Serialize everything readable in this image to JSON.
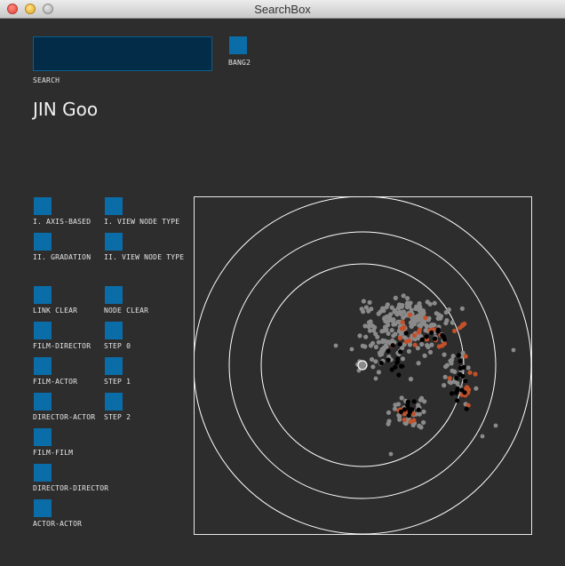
{
  "window": {
    "title": "SearchBox"
  },
  "search": {
    "value": "",
    "label": "SEARCH"
  },
  "bang2": {
    "label": "BANG2"
  },
  "heading": "JIN Goo",
  "buttons": [
    {
      "id": "axis-based",
      "label": "I. AXIS-BASED",
      "col": 0,
      "row": 0
    },
    {
      "id": "view-node-type-1",
      "label": "I. VIEW NODE TYPE",
      "col": 1,
      "row": 0
    },
    {
      "id": "gradation",
      "label": "II. GRADATION",
      "col": 0,
      "row": 1
    },
    {
      "id": "view-node-type-2",
      "label": "II. VIEW NODE TYPE",
      "col": 1,
      "row": 1
    },
    {
      "id": "link-clear",
      "label": "LINK CLEAR",
      "col": 0,
      "row": 2.5
    },
    {
      "id": "node-clear",
      "label": "NODE CLEAR",
      "col": 1,
      "row": 2.5
    },
    {
      "id": "film-director",
      "label": "FILM-DIRECTOR",
      "col": 0,
      "row": 3.5
    },
    {
      "id": "step-0",
      "label": "STEP 0",
      "col": 1,
      "row": 3.5
    },
    {
      "id": "film-actor",
      "label": "FILM-ACTOR",
      "col": 0,
      "row": 4.5
    },
    {
      "id": "step-1",
      "label": "STEP 1",
      "col": 1,
      "row": 4.5
    },
    {
      "id": "director-actor",
      "label": "DIRECTOR-ACTOR",
      "col": 0,
      "row": 5.5
    },
    {
      "id": "step-2",
      "label": "STEP 2",
      "col": 1,
      "row": 5.5
    },
    {
      "id": "film-film",
      "label": "FILM-FILM",
      "col": 0,
      "row": 6.5
    },
    {
      "id": "director-director",
      "label": "DIRECTOR-DIRECTOR",
      "col": 0,
      "row": 7.5
    },
    {
      "id": "actor-actor",
      "label": "ACTOR-ACTOR",
      "col": 0,
      "row": 8.5
    }
  ],
  "colors": {
    "background": "#2d2d2d",
    "button": "#0a6da8",
    "search_fill": "#022c47",
    "ring": "#ffffff",
    "node_gray": "#8a8a8a",
    "node_orange": "#c4502a",
    "node_black": "#000000"
  },
  "icons": {
    "close": "close-light",
    "minimize": "minimize-light",
    "zoom": "zoom-light"
  }
}
